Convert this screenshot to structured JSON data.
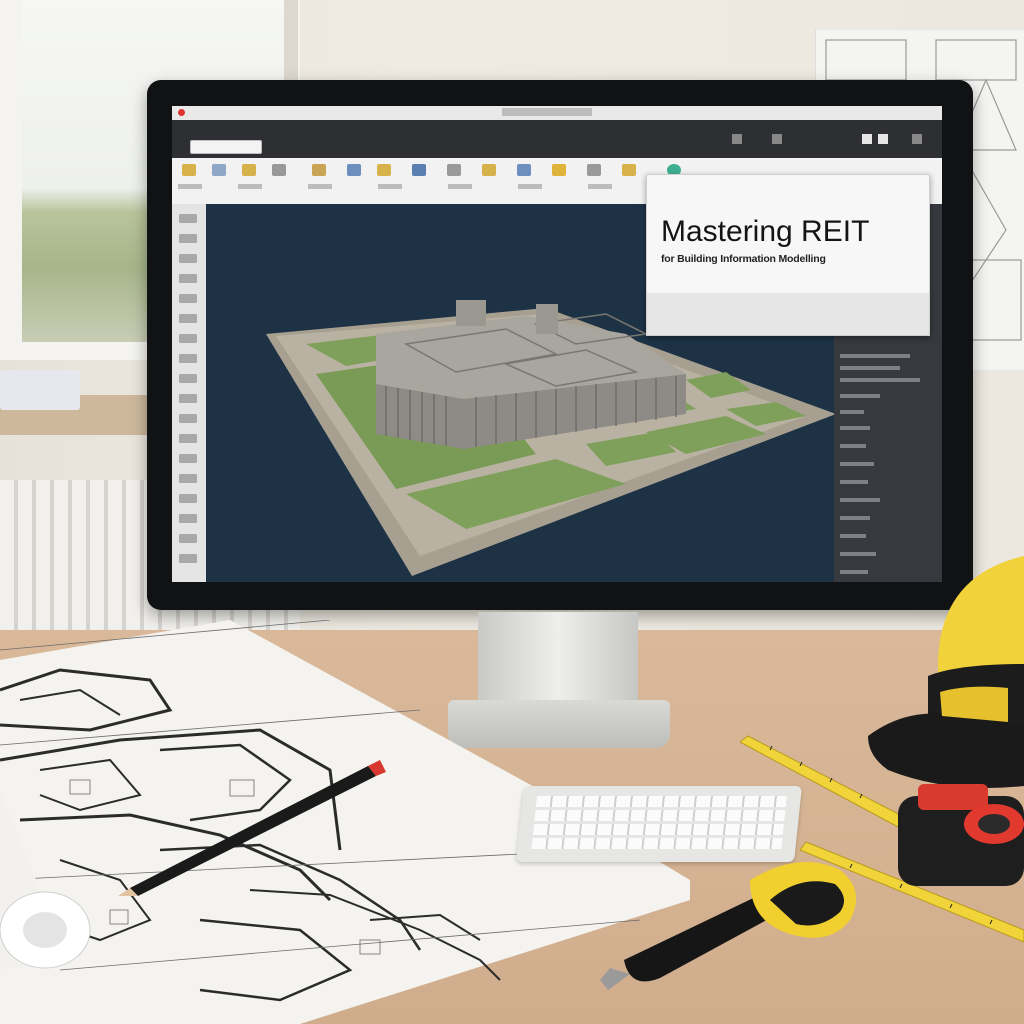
{
  "dialog": {
    "title": "Mastering REIT",
    "subtitle": "for Building Information Modelling"
  },
  "colors": {
    "screen_background": "#1d3245",
    "lawn": "#7fa05a",
    "pavement": "#b8b2a4",
    "building": "#a9a6a0",
    "hardhat": "#f2d23a",
    "tape": "#f0d43a",
    "desk": "#d6b594"
  },
  "icons": {
    "hardhat": "hard-hat-icon",
    "tape_measure": "tape-measure-icon",
    "pencil": "pencil-icon"
  }
}
